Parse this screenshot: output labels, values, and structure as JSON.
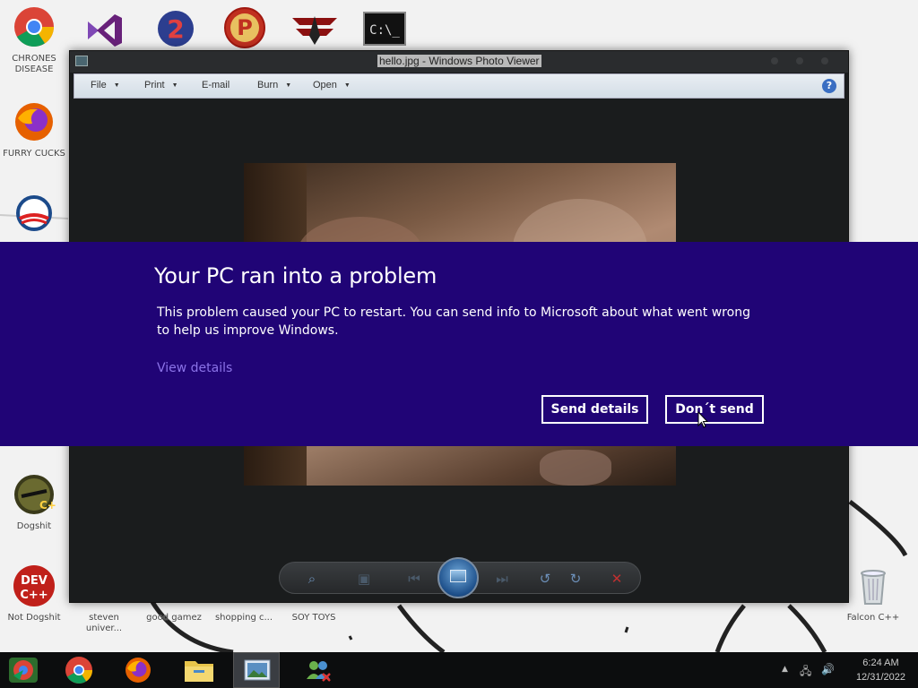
{
  "desktop": {
    "icons": [
      {
        "label": "CHRONES DISEASE",
        "icon": "chrome-icon"
      },
      {
        "label": "FURRY CUCKS",
        "icon": "firefox-icon"
      },
      {
        "label": "Dogshit",
        "icon": "dogshit-icon"
      },
      {
        "label": "Not Dogshit",
        "icon": "devcpp-icon"
      },
      {
        "label": "steven univer...",
        "icon": "file-icon"
      },
      {
        "label": "good gamez",
        "icon": "file-icon"
      },
      {
        "label": "shopping c...",
        "icon": "file-icon"
      },
      {
        "label": "SOY TOYS",
        "icon": "file-icon"
      },
      {
        "label": "Falcon C++",
        "icon": "recycle-bin-icon"
      }
    ]
  },
  "viewer": {
    "title": "hello.jpg - Windows Photo Viewer",
    "menu": [
      {
        "label": "File",
        "dropdown": true
      },
      {
        "label": "Print",
        "dropdown": true
      },
      {
        "label": "E-mail",
        "dropdown": false
      },
      {
        "label": "Burn",
        "dropdown": true
      },
      {
        "label": "Open",
        "dropdown": true
      }
    ],
    "help": "?"
  },
  "bsod": {
    "title": "Your PC ran into a problem",
    "message": "This problem caused your PC to restart. You can send info to Microsoft about what went wrong to help us improve Windows.",
    "view_details": "View details",
    "send_button": "Send details",
    "dont_send_button": "Don´t send",
    "background_color": "#200476",
    "link_color": "#8b73e8"
  },
  "taskbar": {
    "time": "6:24 AM",
    "date": "12/31/2022"
  }
}
